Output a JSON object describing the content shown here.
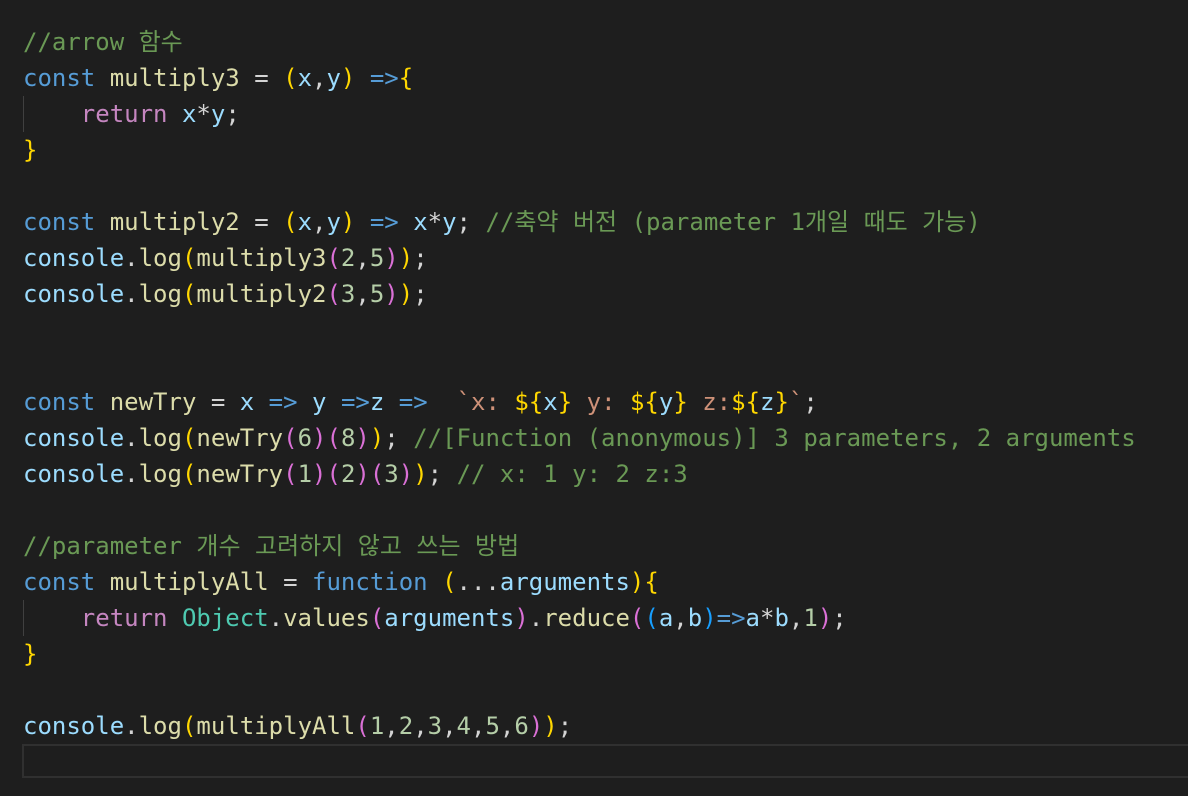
{
  "editor": {
    "lines": [
      {
        "tokens": [
          {
            "t": "//arrow 함수",
            "c": "comment"
          }
        ]
      },
      {
        "tokens": [
          {
            "t": "const",
            "c": "keyword"
          },
          {
            "t": " ",
            "c": "op"
          },
          {
            "t": "multiply3",
            "c": "func"
          },
          {
            "t": " = ",
            "c": "op"
          },
          {
            "t": "(",
            "c": "brace1"
          },
          {
            "t": "x",
            "c": "var"
          },
          {
            "t": ",",
            "c": "punct"
          },
          {
            "t": "y",
            "c": "var"
          },
          {
            "t": ")",
            "c": "brace1"
          },
          {
            "t": " ",
            "c": "op"
          },
          {
            "t": "=>",
            "c": "arrow"
          },
          {
            "t": "{",
            "c": "brace1"
          }
        ]
      },
      {
        "indent": true,
        "tokens": [
          {
            "t": "    ",
            "c": "op"
          },
          {
            "t": "return",
            "c": "control"
          },
          {
            "t": " ",
            "c": "op"
          },
          {
            "t": "x",
            "c": "var"
          },
          {
            "t": "*",
            "c": "op"
          },
          {
            "t": "y",
            "c": "var"
          },
          {
            "t": ";",
            "c": "punct"
          }
        ]
      },
      {
        "tokens": [
          {
            "t": "}",
            "c": "brace1"
          }
        ]
      },
      {
        "tokens": []
      },
      {
        "tokens": [
          {
            "t": "const",
            "c": "keyword"
          },
          {
            "t": " ",
            "c": "op"
          },
          {
            "t": "multiply2",
            "c": "func"
          },
          {
            "t": " = ",
            "c": "op"
          },
          {
            "t": "(",
            "c": "brace1"
          },
          {
            "t": "x",
            "c": "var"
          },
          {
            "t": ",",
            "c": "punct"
          },
          {
            "t": "y",
            "c": "var"
          },
          {
            "t": ")",
            "c": "brace1"
          },
          {
            "t": " ",
            "c": "op"
          },
          {
            "t": "=>",
            "c": "arrow"
          },
          {
            "t": " ",
            "c": "op"
          },
          {
            "t": "x",
            "c": "var"
          },
          {
            "t": "*",
            "c": "op"
          },
          {
            "t": "y",
            "c": "var"
          },
          {
            "t": "; ",
            "c": "punct"
          },
          {
            "t": "//축약 버전 (parameter 1개일 때도 가능)",
            "c": "comment"
          }
        ]
      },
      {
        "tokens": [
          {
            "t": "console",
            "c": "var"
          },
          {
            "t": ".",
            "c": "punct"
          },
          {
            "t": "log",
            "c": "func"
          },
          {
            "t": "(",
            "c": "brace1"
          },
          {
            "t": "multiply3",
            "c": "func"
          },
          {
            "t": "(",
            "c": "brace2"
          },
          {
            "t": "2",
            "c": "number"
          },
          {
            "t": ",",
            "c": "punct"
          },
          {
            "t": "5",
            "c": "number"
          },
          {
            "t": ")",
            "c": "brace2"
          },
          {
            "t": ")",
            "c": "brace1"
          },
          {
            "t": ";",
            "c": "punct"
          }
        ]
      },
      {
        "tokens": [
          {
            "t": "console",
            "c": "var"
          },
          {
            "t": ".",
            "c": "punct"
          },
          {
            "t": "log",
            "c": "func"
          },
          {
            "t": "(",
            "c": "brace1"
          },
          {
            "t": "multiply2",
            "c": "func"
          },
          {
            "t": "(",
            "c": "brace2"
          },
          {
            "t": "3",
            "c": "number"
          },
          {
            "t": ",",
            "c": "punct"
          },
          {
            "t": "5",
            "c": "number"
          },
          {
            "t": ")",
            "c": "brace2"
          },
          {
            "t": ")",
            "c": "brace1"
          },
          {
            "t": ";",
            "c": "punct"
          }
        ]
      },
      {
        "tokens": []
      },
      {
        "tokens": []
      },
      {
        "tokens": [
          {
            "t": "const",
            "c": "keyword"
          },
          {
            "t": " ",
            "c": "op"
          },
          {
            "t": "newTry",
            "c": "func"
          },
          {
            "t": " = ",
            "c": "op"
          },
          {
            "t": "x",
            "c": "var"
          },
          {
            "t": " ",
            "c": "op"
          },
          {
            "t": "=>",
            "c": "arrow"
          },
          {
            "t": " ",
            "c": "op"
          },
          {
            "t": "y",
            "c": "var"
          },
          {
            "t": " ",
            "c": "op"
          },
          {
            "t": "=>",
            "c": "arrow"
          },
          {
            "t": "z",
            "c": "var"
          },
          {
            "t": " ",
            "c": "op"
          },
          {
            "t": "=>",
            "c": "arrow"
          },
          {
            "t": "  ",
            "c": "op"
          },
          {
            "t": "`x: ",
            "c": "string"
          },
          {
            "t": "${",
            "c": "brace1"
          },
          {
            "t": "x",
            "c": "var"
          },
          {
            "t": "}",
            "c": "brace1"
          },
          {
            "t": " y: ",
            "c": "string"
          },
          {
            "t": "${",
            "c": "brace1"
          },
          {
            "t": "y",
            "c": "var"
          },
          {
            "t": "}",
            "c": "brace1"
          },
          {
            "t": " z:",
            "c": "string"
          },
          {
            "t": "${",
            "c": "brace1"
          },
          {
            "t": "z",
            "c": "var"
          },
          {
            "t": "}",
            "c": "brace1"
          },
          {
            "t": "`",
            "c": "string"
          },
          {
            "t": ";",
            "c": "punct"
          }
        ]
      },
      {
        "tokens": [
          {
            "t": "console",
            "c": "var"
          },
          {
            "t": ".",
            "c": "punct"
          },
          {
            "t": "log",
            "c": "func"
          },
          {
            "t": "(",
            "c": "brace1"
          },
          {
            "t": "newTry",
            "c": "func"
          },
          {
            "t": "(",
            "c": "brace2"
          },
          {
            "t": "6",
            "c": "number"
          },
          {
            "t": ")",
            "c": "brace2"
          },
          {
            "t": "(",
            "c": "brace2"
          },
          {
            "t": "8",
            "c": "number"
          },
          {
            "t": ")",
            "c": "brace2"
          },
          {
            "t": ")",
            "c": "brace1"
          },
          {
            "t": "; ",
            "c": "punct"
          },
          {
            "t": "//[Function (anonymous)] 3 parameters, 2 arguments",
            "c": "comment"
          }
        ]
      },
      {
        "tokens": [
          {
            "t": "console",
            "c": "var"
          },
          {
            "t": ".",
            "c": "punct"
          },
          {
            "t": "log",
            "c": "func"
          },
          {
            "t": "(",
            "c": "brace1"
          },
          {
            "t": "newTry",
            "c": "func"
          },
          {
            "t": "(",
            "c": "brace2"
          },
          {
            "t": "1",
            "c": "number"
          },
          {
            "t": ")",
            "c": "brace2"
          },
          {
            "t": "(",
            "c": "brace2"
          },
          {
            "t": "2",
            "c": "number"
          },
          {
            "t": ")",
            "c": "brace2"
          },
          {
            "t": "(",
            "c": "brace2"
          },
          {
            "t": "3",
            "c": "number"
          },
          {
            "t": ")",
            "c": "brace2"
          },
          {
            "t": ")",
            "c": "brace1"
          },
          {
            "t": "; ",
            "c": "punct"
          },
          {
            "t": "// x: 1 y: 2 z:3",
            "c": "comment"
          }
        ]
      },
      {
        "tokens": []
      },
      {
        "tokens": [
          {
            "t": "//parameter 개수 고려하지 않고 쓰는 방법",
            "c": "comment"
          }
        ]
      },
      {
        "tokens": [
          {
            "t": "const",
            "c": "keyword"
          },
          {
            "t": " ",
            "c": "op"
          },
          {
            "t": "multiplyAll",
            "c": "func"
          },
          {
            "t": " = ",
            "c": "op"
          },
          {
            "t": "function",
            "c": "keyword"
          },
          {
            "t": " ",
            "c": "op"
          },
          {
            "t": "(",
            "c": "brace1"
          },
          {
            "t": "...",
            "c": "op"
          },
          {
            "t": "arguments",
            "c": "var"
          },
          {
            "t": ")",
            "c": "brace1"
          },
          {
            "t": "{",
            "c": "brace1"
          }
        ]
      },
      {
        "indent": true,
        "tokens": [
          {
            "t": "    ",
            "c": "op"
          },
          {
            "t": "return",
            "c": "control"
          },
          {
            "t": " ",
            "c": "op"
          },
          {
            "t": "Object",
            "c": "class"
          },
          {
            "t": ".",
            "c": "punct"
          },
          {
            "t": "values",
            "c": "func"
          },
          {
            "t": "(",
            "c": "brace2"
          },
          {
            "t": "arguments",
            "c": "var"
          },
          {
            "t": ")",
            "c": "brace2"
          },
          {
            "t": ".",
            "c": "punct"
          },
          {
            "t": "reduce",
            "c": "func"
          },
          {
            "t": "(",
            "c": "brace2"
          },
          {
            "t": "(",
            "c": "brace3"
          },
          {
            "t": "a",
            "c": "var"
          },
          {
            "t": ",",
            "c": "punct"
          },
          {
            "t": "b",
            "c": "var"
          },
          {
            "t": ")",
            "c": "brace3"
          },
          {
            "t": "=>",
            "c": "arrow"
          },
          {
            "t": "a",
            "c": "var"
          },
          {
            "t": "*",
            "c": "op"
          },
          {
            "t": "b",
            "c": "var"
          },
          {
            "t": ",",
            "c": "punct"
          },
          {
            "t": "1",
            "c": "number"
          },
          {
            "t": ")",
            "c": "brace2"
          },
          {
            "t": ";",
            "c": "punct"
          }
        ]
      },
      {
        "tokens": [
          {
            "t": "}",
            "c": "brace1"
          }
        ]
      },
      {
        "tokens": []
      },
      {
        "tokens": [
          {
            "t": "console",
            "c": "var"
          },
          {
            "t": ".",
            "c": "punct"
          },
          {
            "t": "log",
            "c": "func"
          },
          {
            "t": "(",
            "c": "brace1"
          },
          {
            "t": "multiplyAll",
            "c": "func"
          },
          {
            "t": "(",
            "c": "brace2"
          },
          {
            "t": "1",
            "c": "number"
          },
          {
            "t": ",",
            "c": "punct"
          },
          {
            "t": "2",
            "c": "number"
          },
          {
            "t": ",",
            "c": "punct"
          },
          {
            "t": "3",
            "c": "number"
          },
          {
            "t": ",",
            "c": "punct"
          },
          {
            "t": "4",
            "c": "number"
          },
          {
            "t": ",",
            "c": "punct"
          },
          {
            "t": "5",
            "c": "number"
          },
          {
            "t": ",",
            "c": "punct"
          },
          {
            "t": "6",
            "c": "number"
          },
          {
            "t": ")",
            "c": "brace2"
          },
          {
            "t": ")",
            "c": "brace1"
          },
          {
            "t": ";",
            "c": "punct"
          }
        ]
      },
      {
        "current": true,
        "tokens": []
      }
    ]
  },
  "colors": {
    "background": "#1e1e1e",
    "comment": "#6a9955",
    "keyword": "#569cd6",
    "control": "#c586c0",
    "variable": "#9cdcfe",
    "function": "#dcdcaa",
    "class": "#4ec9b0",
    "number": "#b5cea8",
    "string": "#ce9178",
    "bracket_level_1": "#ffd700",
    "bracket_level_2": "#da70d6",
    "bracket_level_3": "#179fff"
  }
}
